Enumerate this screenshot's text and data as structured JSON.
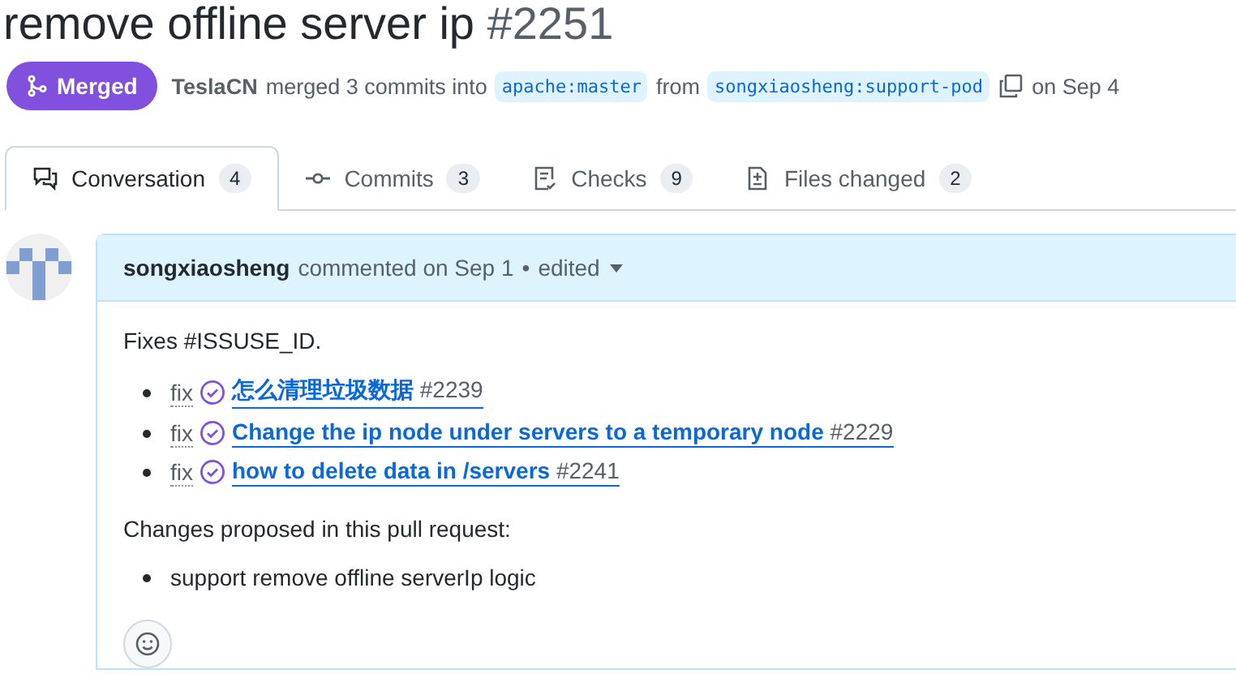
{
  "header": {
    "title": "remove offline server ip",
    "number": "#2251"
  },
  "status": {
    "label": "Merged",
    "kind": "merged"
  },
  "meta": {
    "author": "TeslaCN",
    "text": "merged 3 commits into",
    "base": "apache:master",
    "from": "from",
    "head": "songxiaosheng:support-pod",
    "date": "on Sep 4"
  },
  "tabs": [
    {
      "label": "Conversation",
      "count": "4",
      "kind": "conversation",
      "selected": true
    },
    {
      "label": "Commits",
      "count": "3",
      "kind": "commit",
      "selected": false
    },
    {
      "label": "Checks",
      "count": "9",
      "kind": "checks",
      "selected": false
    },
    {
      "label": "Files changed",
      "count": "2",
      "kind": "files",
      "selected": false
    }
  ],
  "comment": {
    "author": "songxiaosheng",
    "action": "commented on Sep 1",
    "separator": "•",
    "edited": "edited",
    "intro": "Fixes #ISSUSE_ID.",
    "fixes": [
      {
        "prefix": "fix",
        "link": "怎么清理垃圾数据",
        "number": "#2239"
      },
      {
        "prefix": "fix",
        "link": "Change the ip node under servers to a temporary node",
        "number": "#2229"
      },
      {
        "prefix": "fix",
        "link": "how to delete data in /servers",
        "number": "#2241"
      }
    ],
    "changes_heading": "Changes proposed in this pull request:",
    "changes": [
      "support remove offline serverIp logic"
    ]
  }
}
